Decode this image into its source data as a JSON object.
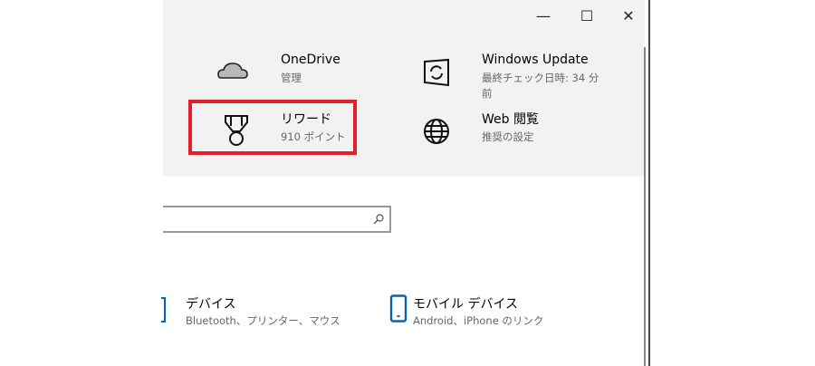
{
  "window_controls": {
    "minimize": "—",
    "maximize": "☐",
    "close": "✕"
  },
  "header_tiles": [
    {
      "title": "OneDrive",
      "subtitle": "管理",
      "icon": "cloud-icon"
    },
    {
      "title": "Windows Update",
      "subtitle": "最終チェック日時: 34 分",
      "subtitle2": "前",
      "icon": "sync-icon"
    },
    {
      "title": "リワード",
      "subtitle": "910 ポイント",
      "icon": "medal-icon"
    },
    {
      "title": "Web 閲覧",
      "subtitle": "推奨の設定",
      "icon": "globe-icon"
    }
  ],
  "search": {
    "placeholder": ""
  },
  "categories": [
    {
      "title": "デバイス",
      "subtitle": "Bluetooth、プリンター、マウス",
      "icon": "devices-icon"
    },
    {
      "title": "モバイル デバイス",
      "subtitle": "Android、iPhone のリンク",
      "icon": "phone-icon"
    }
  ],
  "colors": {
    "highlight": "#e0202a",
    "accent": "#0067b8",
    "header_bg": "#f2f2f2"
  }
}
